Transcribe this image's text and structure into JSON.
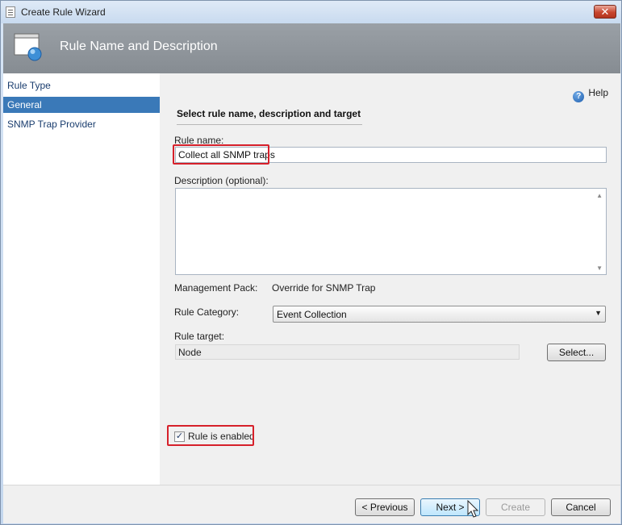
{
  "window": {
    "title": "Create Rule Wizard",
    "close_glyph": "✕"
  },
  "banner": {
    "title": "Rule Name and Description"
  },
  "nav": {
    "items": [
      {
        "label": "Rule Type",
        "selected": false
      },
      {
        "label": "General",
        "selected": true
      },
      {
        "label": "SNMP Trap Provider",
        "selected": false
      }
    ]
  },
  "content": {
    "help_label": "Help",
    "help_glyph": "?",
    "section_title": "Select rule name, description and target",
    "rule_name_label": "Rule name:",
    "rule_name_value": "Collect all SNMP traps",
    "description_label": "Description (optional):",
    "description_value": "",
    "management_pack_label": "Management Pack:",
    "management_pack_value": "Override for SNMP Trap",
    "rule_category_label": "Rule Category:",
    "rule_category_value": "Event Collection",
    "rule_target_label": "Rule target:",
    "rule_target_value": "Node",
    "select_button": "Select...",
    "rule_enabled_label": "Rule is enabled",
    "rule_enabled_checked": true,
    "checkbox_glyph": "✓"
  },
  "footer": {
    "previous": "< Previous",
    "next": "Next >",
    "create": "Create",
    "cancel": "Cancel"
  },
  "colors": {
    "nav_selected": "#3a79b8",
    "highlight": "#d6202a",
    "banner": "#8f959b"
  },
  "icons": [
    "wizard-icon",
    "banner-app-icon",
    "help-icon",
    "close-icon",
    "dropdown-arrow-icon",
    "mouse-cursor-icon"
  ]
}
